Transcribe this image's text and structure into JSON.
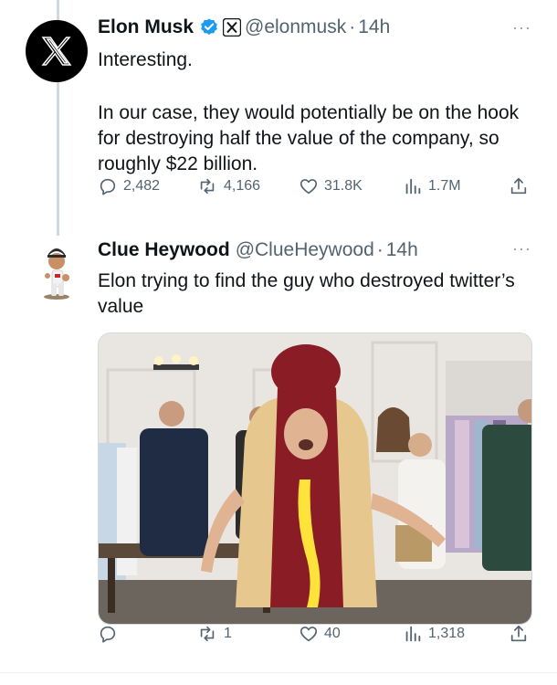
{
  "tweet1": {
    "author_name": "Elon Musk",
    "handle": "@elonmusk",
    "separator": "·",
    "time": "14h",
    "more": "···",
    "text_line1": "Interesting.",
    "text_body": "In our case, they would potentially be on the hook for destroying half the value of the company, so roughly $22 billion.",
    "replies": "2,482",
    "reposts": "4,166",
    "likes": "31.8K",
    "views": "1.7M"
  },
  "tweet2": {
    "author_name": "Clue Heywood",
    "handle": "@ClueHeywood",
    "separator": "·",
    "time": "14h",
    "more": "···",
    "text": "Elon trying to find the guy who destroyed twitter’s value",
    "replies": "",
    "reposts": "1",
    "likes": "40",
    "views": "1,318"
  },
  "colors": {
    "verified": "#1d9bf0",
    "muted": "#536471",
    "text": "#0f1419",
    "thread_line": "#cfd9de"
  },
  "icons": [
    "x-logo-icon",
    "verified-badge-icon",
    "x-affiliate-badge-icon",
    "more-icon",
    "reply-icon",
    "repost-icon",
    "like-icon",
    "views-icon",
    "share-icon"
  ]
}
